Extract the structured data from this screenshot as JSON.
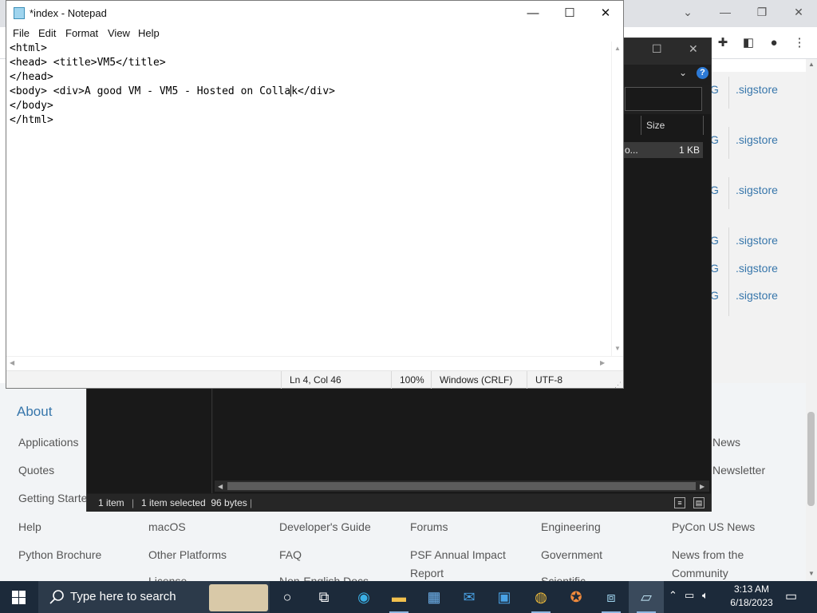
{
  "notepad": {
    "title": "*index - Notepad",
    "menu": [
      "File",
      "Edit",
      "Format",
      "View",
      "Help"
    ],
    "lines": [
      "<html>",
      "<head> <title>VM5</title>",
      "</head>",
      "<body> <div>A good VM - VM5 - Hosted on Colla",
      "</body>",
      "</html>"
    ],
    "line4_after_caret": "k</div>",
    "status": {
      "position": "Ln 4, Col 46",
      "zoom": "100%",
      "line_ending": "Windows (CRLF)",
      "encoding": "UTF-8"
    }
  },
  "explorer": {
    "column_size": "Size",
    "file_name_partial": "o...",
    "file_size": "1 KB",
    "status": {
      "items": "1 item",
      "selected": "1 item selected  96 bytes"
    }
  },
  "browser": {
    "sig_links": [
      ".sigstore",
      ".sigstore",
      ".sigstore",
      ".sigstore",
      ".sigstore",
      ".sigstore"
    ],
    "sig_g": "G",
    "footer": {
      "about_heading": "About",
      "col1": [
        "Applications",
        "Quotes",
        "Getting Started",
        "Help",
        "Python Brochure"
      ],
      "col2": [
        "macOS",
        "Other Platforms",
        "License"
      ],
      "col3": [
        "Developer's Guide",
        "FAQ",
        "Non-English Docs"
      ],
      "col4": [
        "Forums",
        "PSF Annual Impact",
        "Report"
      ],
      "col5": [
        "Engineering",
        "Government",
        "Scientific"
      ],
      "col6": [
        "News",
        "Newsletter",
        "PyCon US News",
        "News from the",
        "Community"
      ]
    }
  },
  "taskbar": {
    "search_placeholder": "Type here to search",
    "time": "3:13 AM",
    "date": "6/18/2023"
  }
}
